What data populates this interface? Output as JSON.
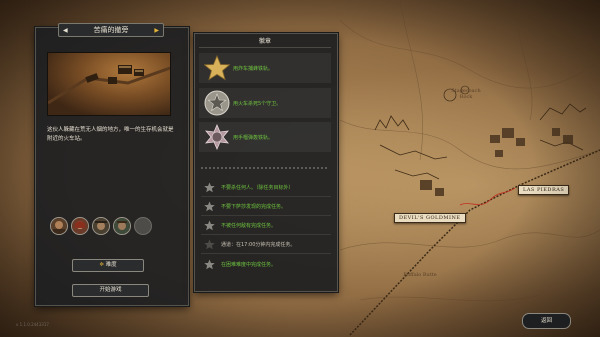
{
  "mission": {
    "title": "苦痛的撤旁",
    "description": "这伙人躲藏在荒无人烟的地方，唯一的生存机会就是附近的火车站。"
  },
  "buttons": {
    "difficulty": "难度",
    "start": "开始游戏",
    "back": "返回"
  },
  "badges": {
    "header": "徽章",
    "items": [
      {
        "text": "用炸车捕蜂铁轨。",
        "icon": "gold-star-badge"
      },
      {
        "text": "用火车杀死5个守卫。",
        "icon": "silver-sheriff-star-badge"
      },
      {
        "text": "用手榴弹轰铁轨。",
        "icon": "rose-sheriff-star-badge"
      }
    ]
  },
  "objectives": [
    {
      "text": "不要杀任何人。（除任务目标外）",
      "icon": "grey-star-icon"
    },
    {
      "text": "不要下萨莎发现的完成任务。",
      "icon": "grey-star-icon"
    },
    {
      "text": "不被任何敌有完成任务。",
      "icon": "grey-star-icon"
    },
    {
      "text": "通道：在17:00分钟内完成任务。",
      "icon": "grey-star-icon"
    },
    {
      "text": "在困难难度中完成任务。",
      "icon": "grey-star-icon"
    }
  ],
  "map": {
    "town_1": "LAS PIEDRAS",
    "town_2": "DEVIL'S GOLDMINE",
    "label_1": "Stagecoach Rock",
    "label_2": "Buffalo Butte"
  },
  "version": "v 1.1.0.2443317",
  "colors": {
    "accent_yellow": "#e2b338",
    "objective_green": "#6ec33f",
    "panel_bg": "#1e1f21"
  }
}
